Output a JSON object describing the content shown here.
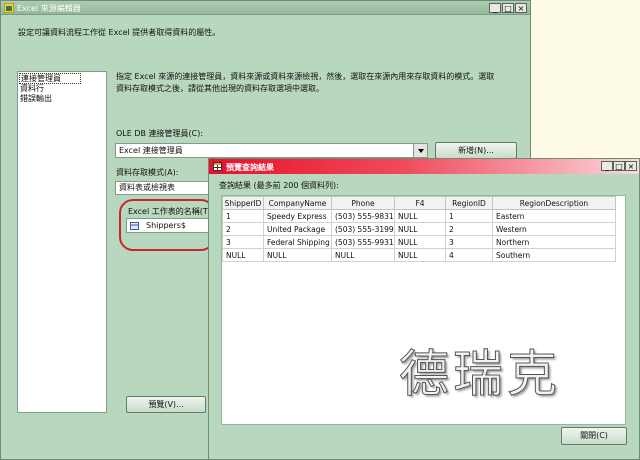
{
  "window": {
    "title": "Excel 來源編輯器",
    "description": "設定可讓資料流程工作從 Excel 提供者取得資料的屬性。",
    "controls": {
      "minimize": "_",
      "maximize": "□",
      "close": "×"
    }
  },
  "sidebar": {
    "items": [
      {
        "label": "連接管理員",
        "selected": true
      },
      {
        "label": "資料行"
      },
      {
        "label": "錯誤輸出"
      }
    ]
  },
  "main": {
    "instructions": "指定 Excel 來源的連接管理員，資料來源或資料來源檢視，然後，選取在來源內用來存取資料的模式。選取資料存取模式之後，請從其他出現的資料存取選項中選取。",
    "conn_label": "OLE DB 連接管理員(C):",
    "conn_value": "Excel 連接管理員",
    "new_button": "新增(N)...",
    "access_label": "資料存取模式(A):",
    "access_value": "資料表或檢視表",
    "sheet_label": "Excel 工作表的名稱(T):",
    "sheet_value": "Shippers$",
    "preview_button": "預覽(V)..."
  },
  "preview": {
    "title": "預覽查詢結果",
    "subtitle": "查詢結果 (最多前 200 個資料列):",
    "close_button": "關閉(C)",
    "columns": [
      "ShipperID",
      "CompanyName",
      "Phone",
      "F4",
      "RegionID",
      "RegionDescription"
    ],
    "rows": [
      [
        "1",
        "Speedy Express",
        "(503) 555-9831",
        "NULL",
        "1",
        "Eastern"
      ],
      [
        "2",
        "United Package",
        "(503) 555-3199",
        "NULL",
        "2",
        "Western"
      ],
      [
        "3",
        "Federal Shipping",
        "(503) 555-9931",
        "NULL",
        "3",
        "Northern"
      ],
      [
        "NULL",
        "NULL",
        "NULL",
        "NULL",
        "4",
        "Southern"
      ]
    ],
    "watermark": "德瑞克"
  },
  "colors": {
    "highlight": "#c62828",
    "title_gradient": "#e8102a",
    "window_bg": "#b7d7bf"
  }
}
